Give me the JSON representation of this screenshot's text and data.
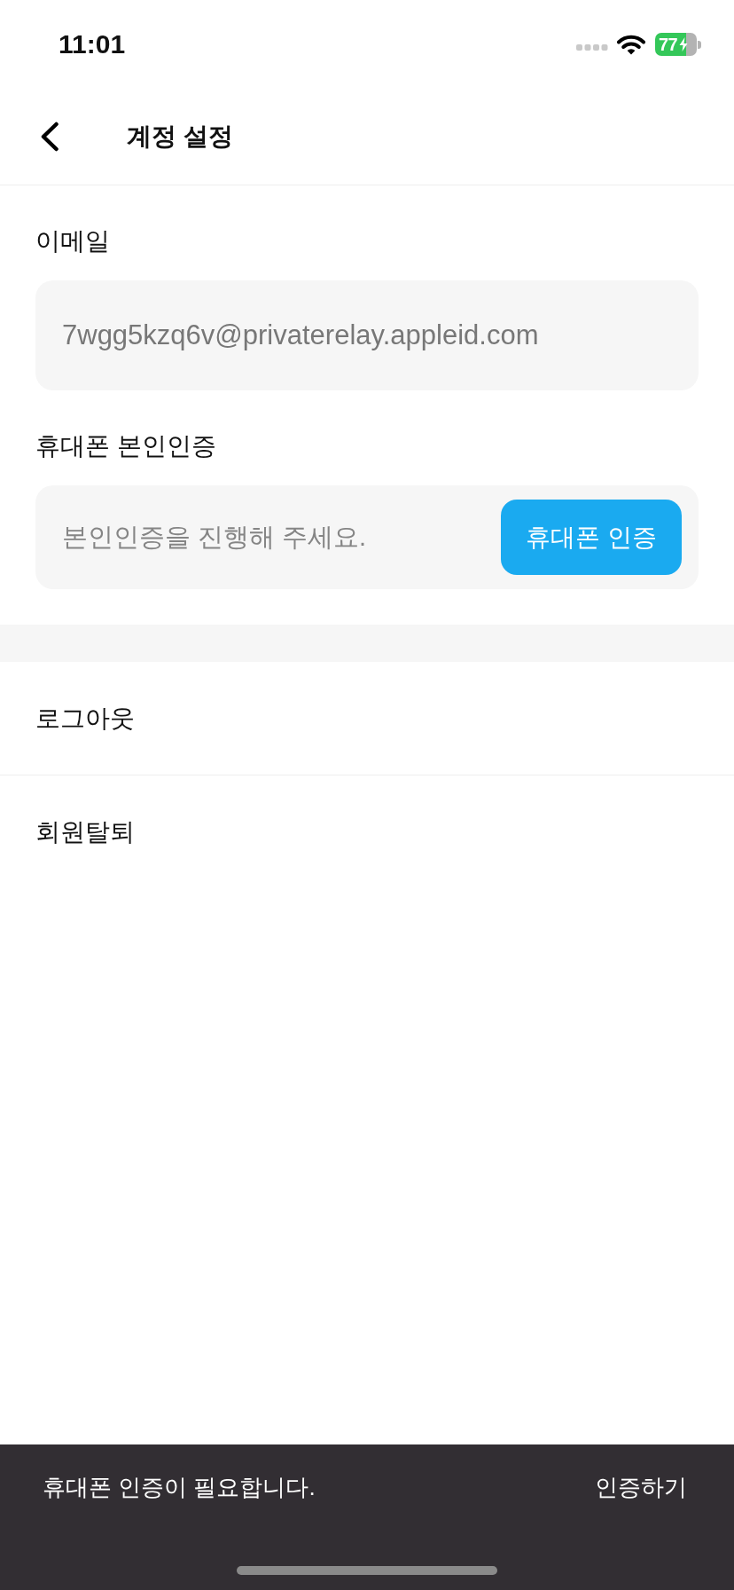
{
  "status_bar": {
    "time": "11:01",
    "battery": "77"
  },
  "header": {
    "title": "계정 설정"
  },
  "sections": [
    {
      "label": "이메일",
      "field": {
        "value": "7wgg5kzq6v@privaterelay.appleid.com"
      }
    },
    {
      "label": "휴대폰 본인인증",
      "field": {
        "placeholder": "본인인증을 진행해 주세요."
      },
      "button": "휴대폰 인증"
    }
  ],
  "menu": [
    {
      "label": "로그아웃"
    },
    {
      "label": "회원탈퇴"
    }
  ],
  "snackbar": {
    "message": "휴대폰 인증이 필요합니다.",
    "action": "인증하기"
  }
}
